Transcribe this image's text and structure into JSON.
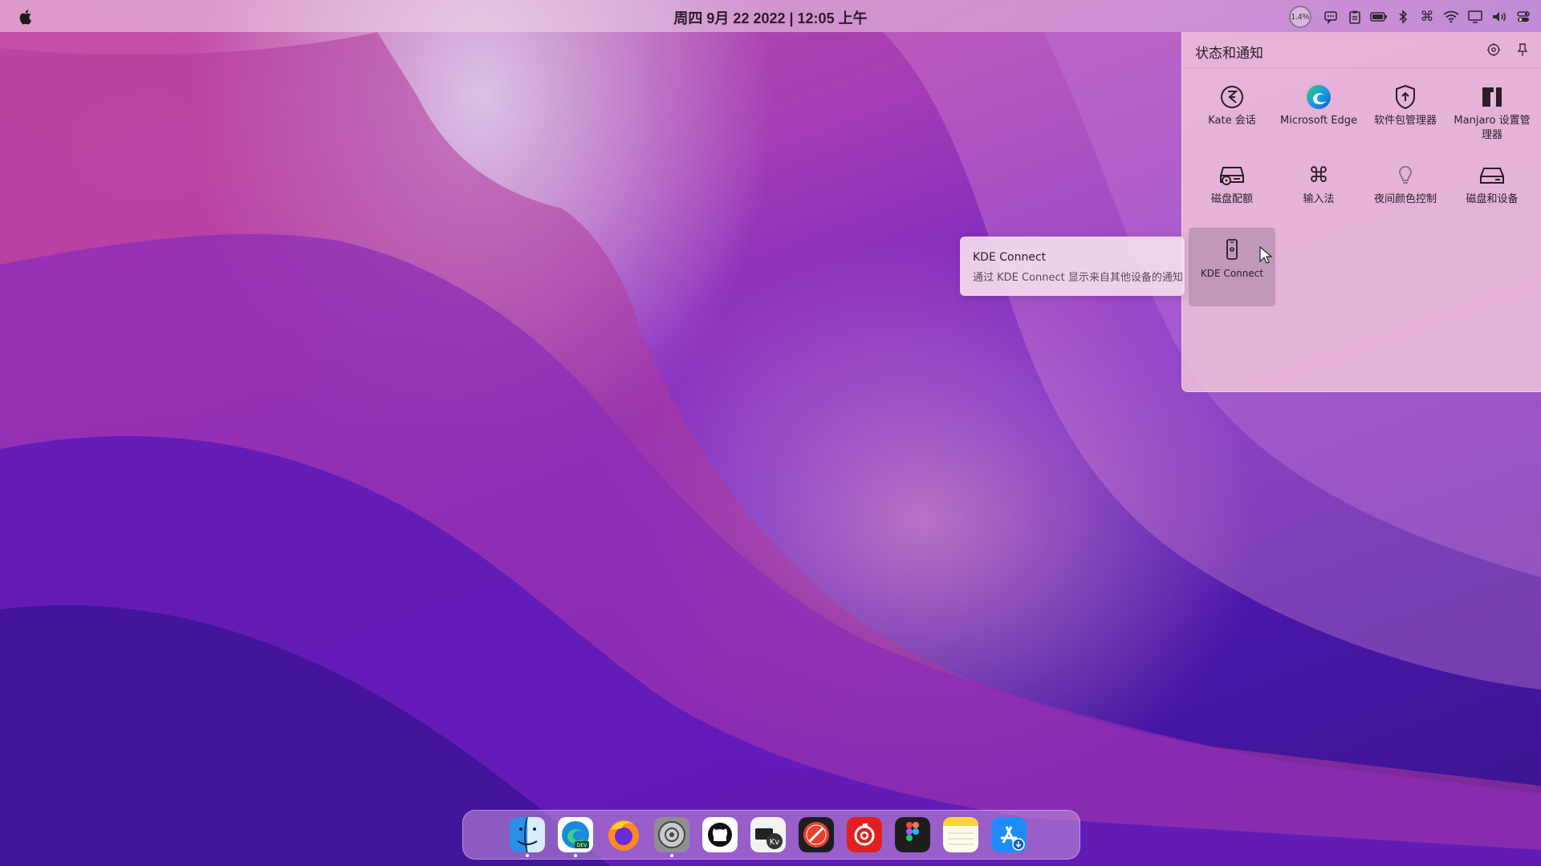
{
  "menubar": {
    "apple_icon": "apple-logo-icon",
    "clock": "周四 9月 22 2022 | 12:05 上午",
    "cpu_load": "1.4%",
    "tray_icons": [
      "notification-icon",
      "clipboard-icon",
      "battery-icon",
      "bluetooth-icon",
      "input-method-icon",
      "wifi-icon",
      "display-icon",
      "volume-icon",
      "control-center-icon"
    ]
  },
  "panel": {
    "title": "状态和通知",
    "settings_icon": "gear-icon",
    "pin_icon": "pin-icon",
    "items": [
      {
        "label": "Kate 会话",
        "icon": "kate-icon"
      },
      {
        "label": "Microsoft Edge",
        "icon": "edge-icon"
      },
      {
        "label": "软件包管理器",
        "icon": "shield-update-icon"
      },
      {
        "label": "Manjaro 设置管理器",
        "icon": "manjaro-icon"
      },
      {
        "label": "磁盘配额",
        "icon": "disk-quota-icon"
      },
      {
        "label": "输入法",
        "icon": "command-key-icon"
      },
      {
        "label": "夜间颜色控制",
        "icon": "lightbulb-icon"
      },
      {
        "label": "磁盘和设备",
        "icon": "drive-icon"
      },
      {
        "label": "KDE Connect",
        "icon": "phone-icon"
      }
    ]
  },
  "tooltip": {
    "title": "KDE Connect",
    "subtitle": "通过 KDE Connect 显示来自其他设备的通知"
  },
  "dock": {
    "apps": [
      "finder",
      "edge-dev",
      "firefox",
      "system-preferences",
      "github",
      "kdenlive",
      "instruments",
      "netease-music",
      "figma",
      "notes",
      "app-store"
    ],
    "running": [
      "finder",
      "edge-dev",
      "system-preferences"
    ]
  },
  "colors": {
    "accent": "#c0509c",
    "panel_bg": "#eebeda",
    "text": "#2a1f2a"
  }
}
